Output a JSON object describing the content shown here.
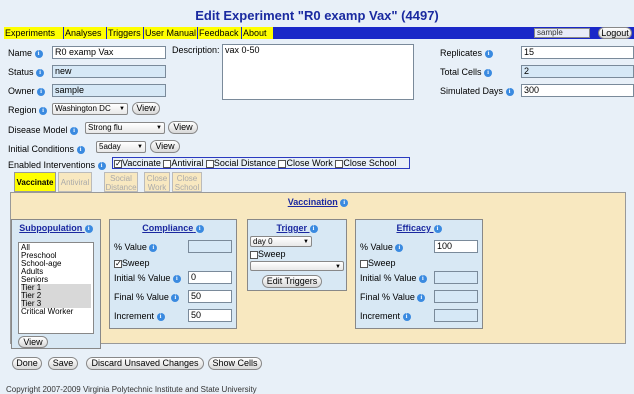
{
  "title": "Edit Experiment \"R0 examp Vax\" (4497)",
  "nav": {
    "items": [
      "Experiments",
      "Analyses",
      "Triggers",
      "User Manual",
      "Feedback",
      "About"
    ],
    "user": "sample",
    "logout": "Logout"
  },
  "fields": {
    "name_label": "Name",
    "name_value": "R0 examp Vax",
    "status_label": "Status",
    "status_value": "new",
    "owner_label": "Owner",
    "owner_value": "sample",
    "description_label": "Description:",
    "description_value": "vax 0-50",
    "replicates_label": "Replicates",
    "replicates_value": "15",
    "total_cells_label": "Total Cells",
    "total_cells_value": "2",
    "simulated_days_label": "Simulated Days",
    "simulated_days_value": "300",
    "region_label": "Region",
    "region_value": "Washington DC",
    "disease_label": "Disease Model",
    "disease_value": "Strong flu",
    "initial_label": "Initial Conditions",
    "initial_value": "5aday",
    "view": "View"
  },
  "interventions": {
    "label": "Enabled Interventions",
    "items": [
      "Vaccinate",
      "Antiviral",
      "Social Distance",
      "Close Work",
      "Close School"
    ]
  },
  "tabs": [
    {
      "l1": "Vaccinate",
      "l2": ""
    },
    {
      "l1": "Antiviral",
      "l2": ""
    },
    {
      "l1": "Social",
      "l2": "Distance"
    },
    {
      "l1": "Close",
      "l2": "Work"
    },
    {
      "l1": "Close",
      "l2": "School"
    }
  ],
  "vaccination": {
    "heading": "Vaccination",
    "subpop": {
      "heading": "Subpopulation",
      "items": [
        "All",
        "Preschool",
        "School-age",
        "Adults",
        "Seniors",
        "Tier 1",
        "Tier 2",
        "Tier 3",
        "Critical Worker"
      ],
      "view": "View"
    },
    "compliance": {
      "heading": "Compliance",
      "pct_label": "% Value",
      "sweep": "Sweep",
      "initial_label": "Initial % Value",
      "initial_value": "0",
      "final_label": "Final % Value",
      "final_value": "50",
      "increment_label": "Increment",
      "increment_value": "50"
    },
    "trigger": {
      "heading": "Trigger",
      "select": "day 0",
      "sweep": "Sweep",
      "edit": "Edit Triggers"
    },
    "efficacy": {
      "heading": "Efficacy",
      "pct_label": "% Value",
      "pct_value": "100",
      "sweep": "Sweep",
      "initial_label": "Initial % Value",
      "final_label": "Final % Value",
      "increment_label": "Increment"
    }
  },
  "actions": {
    "done": "Done",
    "save": "Save",
    "discard": "Discard Unsaved Changes",
    "show_cells": "Show Cells"
  },
  "footer": "Copyright 2007-2009 Virginia Polytechnic Institute and State University"
}
